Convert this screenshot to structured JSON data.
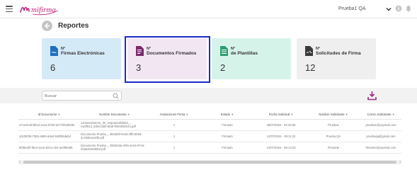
{
  "header": {
    "logo_text": "mifirma",
    "user_name": "Prueba1 QA",
    "brand_color": "#c0237a"
  },
  "page": {
    "title": "Reportes"
  },
  "cards": [
    {
      "prefix": "N°",
      "label": "Firmas Electrónicas",
      "value": "6",
      "icon": "signature-doc-icon",
      "color": "#d5eaf7"
    },
    {
      "prefix": "N°",
      "label": "Documentos Firmados",
      "value": "3",
      "icon": "signed-document-icon",
      "color": "#f3e6f3"
    },
    {
      "prefix": "N°",
      "label": "de Plantillas",
      "value": "2",
      "icon": "template-icon",
      "color": "#d6f3ea"
    },
    {
      "prefix": "N°",
      "label": "Solicitudes de Firma",
      "value": "12",
      "icon": "request-signature-icon",
      "color": "#efefef"
    }
  ],
  "search": {
    "placeholder": "Buscar"
  },
  "table": {
    "columns": [
      "Id Documento",
      "Nombre Documento",
      "Anotaciones Firma",
      "Estado",
      "Fecha Solicitud",
      "Nombre Solicitante",
      "Correo Solicitante"
    ],
    "rows": [
      [
        "a71e6c3d-8bcd-4e2a-8760-b277bfa4b03b",
        "consentimiento_de_responsabilidad_... nw3f01d_5d0c4380-5fab-f0003fd0244.pdf",
        "1",
        "Firmado",
        "25/07/2024 - 02:32:50",
        "Prueba1",
        "prueba1@yopmail.com"
      ],
      [
        "4dc0bf36-7983-4680-a9ed-bd6f55dafaf",
        "Documento Prueba _ 4b63d9f-9c0d-4ffb-9b0d-3c1b6b11e6f5.pdf",
        "1",
        "Firmado",
        "12/07/2024 - 09:11:22",
        "Prueba QA",
        "pruebaqa@gmail.com"
      ],
      [
        "8fd8ed2f-f9e3-4ec0-b21e-1b4-ae0f60af6",
        "Documento Prueba _ 1f82b3da-ef29-4e10-9744-eba6d1b83bbd.pdf",
        "1",
        "Firmado",
        "12/07/2024 - 09:13:23",
        "Firmante",
        "firmante@yopmail.com"
      ]
    ]
  }
}
